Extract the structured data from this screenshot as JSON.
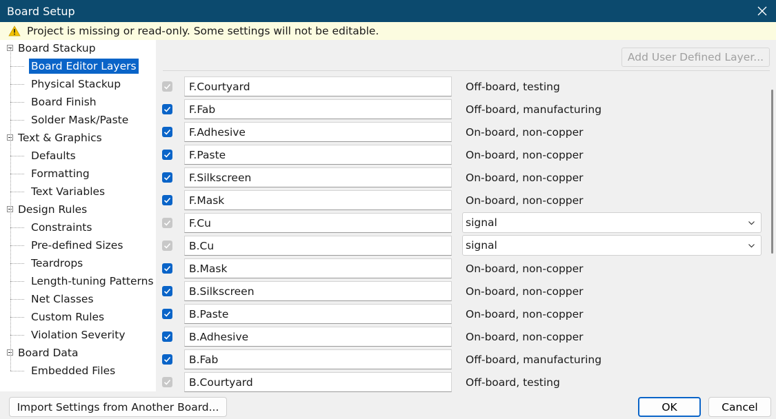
{
  "window": {
    "title": "Board Setup"
  },
  "banner": {
    "message": "Project is missing or read-only. Some settings will not be editable."
  },
  "tree": {
    "groups": [
      {
        "label": "Board Stackup",
        "children": [
          "Board Editor Layers",
          "Physical Stackup",
          "Board Finish",
          "Solder Mask/Paste"
        ]
      },
      {
        "label": "Text & Graphics",
        "children": [
          "Defaults",
          "Formatting",
          "Text Variables"
        ]
      },
      {
        "label": "Design Rules",
        "children": [
          "Constraints",
          "Pre-defined Sizes",
          "Teardrops",
          "Length-tuning Patterns",
          "Net Classes",
          "Custom Rules",
          "Violation Severity"
        ]
      },
      {
        "label": "Board Data",
        "children": [
          "Embedded Files"
        ]
      }
    ],
    "selected": "Board Editor Layers"
  },
  "panel": {
    "add_button": "Add User Defined Layer...",
    "layers": [
      {
        "name": "F.Courtyard",
        "checked": true,
        "enabled": false,
        "type": "Off-board, testing",
        "dropdown": false
      },
      {
        "name": "F.Fab",
        "checked": true,
        "enabled": true,
        "type": "Off-board, manufacturing",
        "dropdown": false
      },
      {
        "name": "F.Adhesive",
        "checked": true,
        "enabled": true,
        "type": "On-board, non-copper",
        "dropdown": false
      },
      {
        "name": "F.Paste",
        "checked": true,
        "enabled": true,
        "type": "On-board, non-copper",
        "dropdown": false
      },
      {
        "name": "F.Silkscreen",
        "checked": true,
        "enabled": true,
        "type": "On-board, non-copper",
        "dropdown": false
      },
      {
        "name": "F.Mask",
        "checked": true,
        "enabled": true,
        "type": "On-board, non-copper",
        "dropdown": false
      },
      {
        "name": "F.Cu",
        "checked": true,
        "enabled": false,
        "type": "signal",
        "dropdown": true
      },
      {
        "name": "B.Cu",
        "checked": true,
        "enabled": false,
        "type": "signal",
        "dropdown": true
      },
      {
        "name": "B.Mask",
        "checked": true,
        "enabled": true,
        "type": "On-board, non-copper",
        "dropdown": false
      },
      {
        "name": "B.Silkscreen",
        "checked": true,
        "enabled": true,
        "type": "On-board, non-copper",
        "dropdown": false
      },
      {
        "name": "B.Paste",
        "checked": true,
        "enabled": true,
        "type": "On-board, non-copper",
        "dropdown": false
      },
      {
        "name": "B.Adhesive",
        "checked": true,
        "enabled": true,
        "type": "On-board, non-copper",
        "dropdown": false
      },
      {
        "name": "B.Fab",
        "checked": true,
        "enabled": true,
        "type": "Off-board, manufacturing",
        "dropdown": false
      },
      {
        "name": "B.Courtyard",
        "checked": true,
        "enabled": false,
        "type": "Off-board, testing",
        "dropdown": false
      }
    ]
  },
  "footer": {
    "import_button": "Import Settings from Another Board...",
    "ok_button": "OK",
    "cancel_button": "Cancel"
  },
  "colors": {
    "titlebar": "#0c4a6e",
    "accent": "#0a64c8",
    "banner": "#fcfce0",
    "warning": "#f2c200"
  }
}
